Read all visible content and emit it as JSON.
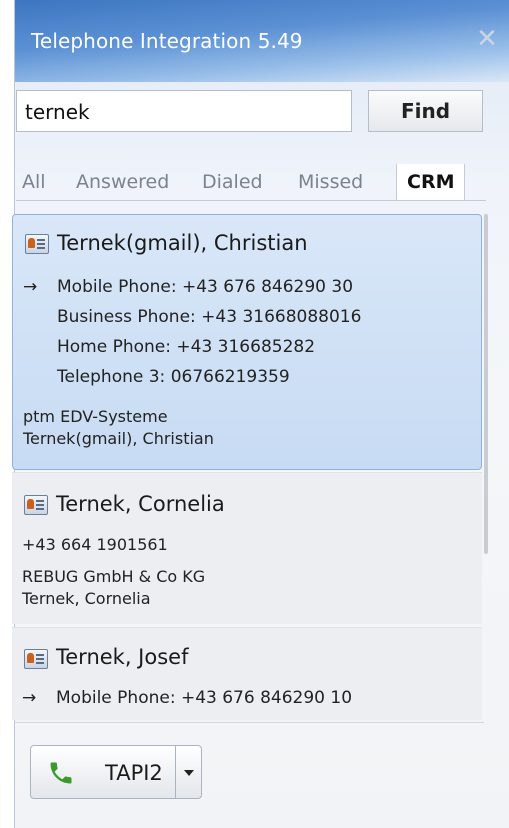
{
  "window": {
    "title": "Telephone Integration 5.49",
    "close_glyph": "✕"
  },
  "search": {
    "value": "ternek",
    "find_label": "Find"
  },
  "tabs": [
    {
      "label": "All"
    },
    {
      "label": "Answered"
    },
    {
      "label": "Dialed"
    },
    {
      "label": "Missed"
    },
    {
      "label": "CRM",
      "active": true
    }
  ],
  "results": [
    {
      "name": "Ternek(gmail), Christian",
      "phones": [
        {
          "arrow": "→",
          "text": "Mobile Phone: +43 676 846290 30"
        },
        {
          "arrow": "",
          "text": "Business Phone: +43 31668088016"
        },
        {
          "arrow": "",
          "text": "Home Phone: +43 316685282"
        },
        {
          "arrow": "",
          "text": "Telephone 3: 06766219359"
        }
      ],
      "company": "ptm EDV-Systeme",
      "display": "Ternek(gmail), Christian"
    },
    {
      "name": "Ternek, Cornelia",
      "number": "+43 664 1901561",
      "company": "REBUG GmbH & Co KG",
      "display": "Ternek, Cornelia"
    },
    {
      "name": "Ternek, Josef",
      "phones": [
        {
          "arrow": "→",
          "text": "Mobile Phone: +43 676 846290 10"
        }
      ]
    }
  ],
  "dial": {
    "label": "TAPI2"
  },
  "colors": {
    "accent": "#3d76c0",
    "phone_green": "#3a9a2c",
    "selection": "#c7dbf3"
  },
  "icons": {
    "contact": "contact-card-icon",
    "phone": "phone-icon",
    "dropdown": "chevron-down-icon"
  }
}
